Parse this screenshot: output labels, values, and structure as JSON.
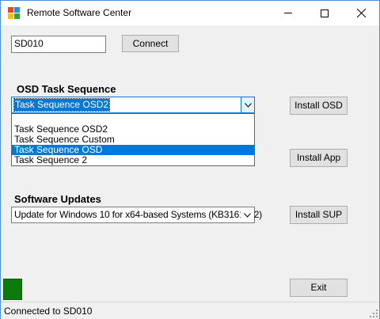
{
  "window": {
    "title": "Remote Software Center"
  },
  "connection": {
    "computer_name": "SD010",
    "connect_label": "Connect"
  },
  "osd": {
    "section_label": "OSD Task Sequence",
    "selected": "Task Sequence OSD2",
    "install_label": "Install OSD",
    "options": [
      "Task Sequence OSD2",
      "Task Sequence Custom",
      "Task Sequence OSD",
      "Task Sequence 2"
    ],
    "highlighted_option": "Task Sequence OSD"
  },
  "app": {
    "install_label": "Install App"
  },
  "sup": {
    "section_label": "Software Updates",
    "selected": "Update for Windows 10 for x64-based Systems (KB3161102)",
    "install_label": "Install SUP"
  },
  "exit_label": "Exit",
  "status": {
    "text": "Connected to SD010",
    "indicator_color": "#0d7a0d"
  },
  "colors": {
    "accent": "#0078d7"
  }
}
